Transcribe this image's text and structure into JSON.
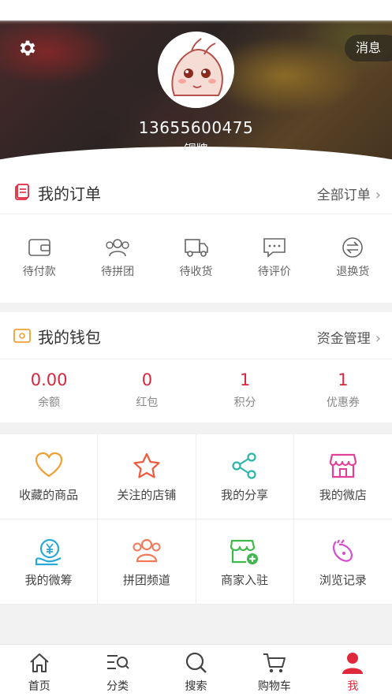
{
  "header": {
    "message_label": "消息",
    "phone": "13655600475",
    "level": "铜牌",
    "icons": {
      "settings": "gear-icon",
      "avatar": "cartoon-avatar"
    }
  },
  "orders": {
    "title": "我的订单",
    "more_label": "全部订单",
    "items": [
      {
        "label": "待付款",
        "icon": "wallet-icon"
      },
      {
        "label": "待拼团",
        "icon": "group-icon"
      },
      {
        "label": "待收货",
        "icon": "truck-icon"
      },
      {
        "label": "待评价",
        "icon": "comment-icon"
      },
      {
        "label": "退换货",
        "icon": "exchange-icon"
      }
    ]
  },
  "wallet": {
    "title": "我的钱包",
    "more_label": "资金管理",
    "items": [
      {
        "value": "0.00",
        "label": "余额"
      },
      {
        "value": "0",
        "label": "红包"
      },
      {
        "value": "1",
        "label": "积分"
      },
      {
        "value": "1",
        "label": "优惠券"
      }
    ]
  },
  "features": [
    {
      "label": "收藏的商品",
      "icon": "heart-icon"
    },
    {
      "label": "关注的店铺",
      "icon": "star-icon"
    },
    {
      "label": "我的分享",
      "icon": "share-icon"
    },
    {
      "label": "我的微店",
      "icon": "shop-icon"
    },
    {
      "label": "我的微筹",
      "icon": "crowdfund-icon"
    },
    {
      "label": "拼团频道",
      "icon": "group-channel-icon"
    },
    {
      "label": "商家入驻",
      "icon": "merchant-icon"
    },
    {
      "label": "浏览记录",
      "icon": "history-icon"
    }
  ],
  "tabbar": [
    {
      "label": "首页",
      "icon": "home-icon"
    },
    {
      "label": "分类",
      "icon": "category-icon"
    },
    {
      "label": "搜索",
      "icon": "search-icon"
    },
    {
      "label": "购物车",
      "icon": "cart-icon"
    },
    {
      "label": "我",
      "icon": "user-icon",
      "active": true
    }
  ],
  "colors": {
    "accent": "#e0283c",
    "value_red": "#d7263d"
  }
}
